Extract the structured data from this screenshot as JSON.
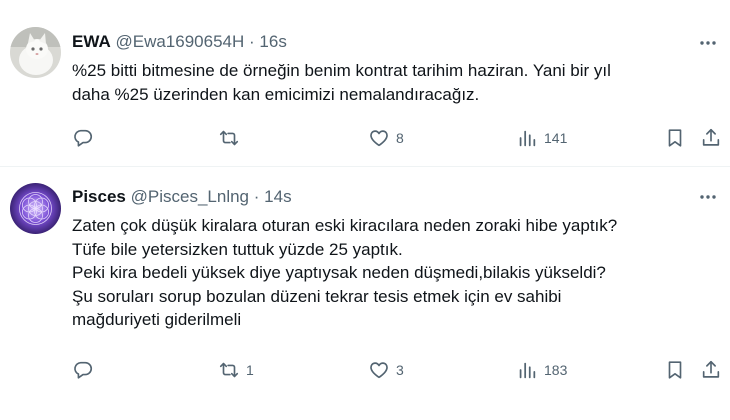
{
  "tweets": [
    {
      "display_name": "EWA",
      "handle": "@Ewa1690654H",
      "separator": "·",
      "time": "16s",
      "avatar": "white-cat-photo",
      "lines": [
        "%25 bitti bitmesine de örneğin benim kontrat tarihim haziran. Yani bir yıl",
        "daha %25 üzerinden kan emicimizi nemalandıracağız."
      ],
      "stats": {
        "replies": "",
        "retweets": "",
        "likes": "8",
        "views": "141"
      }
    },
    {
      "display_name": "Pisces",
      "handle": "@Pisces_Lnlng",
      "separator": "·",
      "time": "14s",
      "avatar": "purple-flower-of-life-pattern",
      "lines": [
        "Zaten çok düşük kiralara oturan eski kiracılara neden zoraki hibe yaptık?",
        "Tüfe bile yetersizken tuttuk yüzde 25 yaptık.",
        "Peki kira bedeli yüksek diye yaptıysak neden düşmedi,bilakis yükseldi?",
        "Şu soruları sorup bozulan düzeni tekrar tesis etmek için ev sahibi",
        "mağduriyeti giderilmeli"
      ],
      "stats": {
        "replies": "",
        "retweets": "1",
        "likes": "3",
        "views": "183"
      }
    }
  ],
  "colors": {
    "text": "#0f1419",
    "secondary": "#536471",
    "divider": "#eff3f4"
  }
}
